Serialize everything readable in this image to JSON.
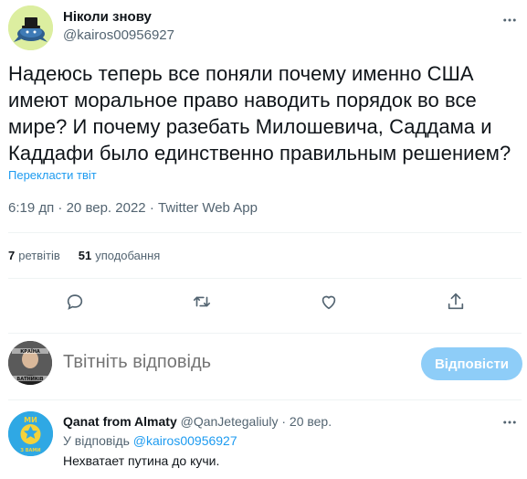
{
  "author": {
    "name": "Ніколи знову",
    "handle": "@kairos00956927"
  },
  "tweet": {
    "text": "Надеюсь теперь все поняли почему именно США имеют моральное право наводить порядок во все мире? И почему разебать Милошевича, Саддама и Каддафи было единственно правильным решением?",
    "translate_label": "Перекласти твіт",
    "time": "6:19 дп",
    "date": "20 вер. 2022",
    "source": "Twitter Web App",
    "separator": "·"
  },
  "stats": {
    "retweets_count": "7",
    "retweets_label": "ретвітів",
    "likes_count": "51",
    "likes_label": "уподобання"
  },
  "composer": {
    "placeholder": "Твітніть відповідь",
    "button_label": "Відповісти"
  },
  "reply": {
    "name": "Qanat from Almaty",
    "handle": "@QanJetegaliuly",
    "separator": "·",
    "date": "20 вер.",
    "replying_prefix": "У відповідь",
    "replying_handle": "@kairos00956927",
    "text": "Нехватает путина до кучи."
  },
  "avatar_reply_text": {
    "top": "МИ",
    "bottom": "З ВАМИ"
  },
  "avatar_me_text": {
    "top": "КРАЇНА",
    "bottom": "ВАТНИКІВ"
  },
  "colors": {
    "accent": "#1d9bf0",
    "button_disabled": "#8ecdf8",
    "secondary_text": "#536471"
  }
}
